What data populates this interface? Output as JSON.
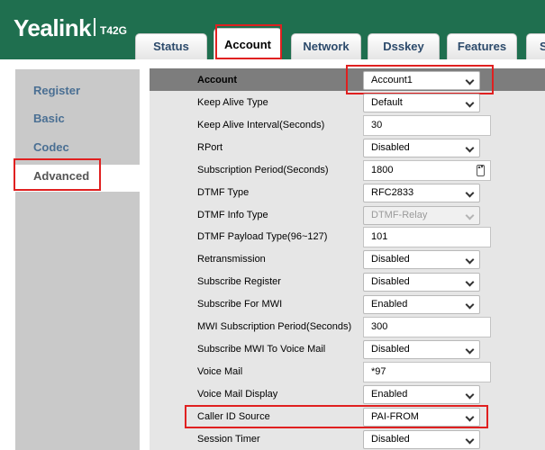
{
  "brand": {
    "logo": "Yealink",
    "model": "T42G"
  },
  "tabs": [
    {
      "label": "Status"
    },
    {
      "label": "Account"
    },
    {
      "label": "Network"
    },
    {
      "label": "Dsskey"
    },
    {
      "label": "Features"
    },
    {
      "label": "S"
    }
  ],
  "sidebar": {
    "items": [
      {
        "label": "Register"
      },
      {
        "label": "Basic"
      },
      {
        "label": "Codec"
      },
      {
        "label": "Advanced"
      }
    ]
  },
  "form": {
    "account": {
      "label": "Account",
      "value": "Account1"
    },
    "rows": [
      {
        "label": "Keep Alive Type",
        "type": "select",
        "value": "Default"
      },
      {
        "label": "Keep Alive Interval(Seconds)",
        "type": "input",
        "value": "30"
      },
      {
        "label": "RPort",
        "type": "select",
        "value": "Disabled"
      },
      {
        "label": "Subscription Period(Seconds)",
        "type": "spin",
        "value": "1800"
      },
      {
        "label": "DTMF Type",
        "type": "select",
        "value": "RFC2833"
      },
      {
        "label": "DTMF Info Type",
        "type": "select-disabled",
        "value": "DTMF-Relay"
      },
      {
        "label": "DTMF Payload Type(96~127)",
        "type": "input",
        "value": "101"
      },
      {
        "label": "Retransmission",
        "type": "select",
        "value": "Disabled"
      },
      {
        "label": "Subscribe Register",
        "type": "select",
        "value": "Disabled"
      },
      {
        "label": "Subscribe For MWI",
        "type": "select",
        "value": "Enabled"
      },
      {
        "label": "MWI Subscription Period(Seconds)",
        "type": "input",
        "value": "300"
      },
      {
        "label": "Subscribe MWI To Voice Mail",
        "type": "select",
        "value": "Disabled"
      },
      {
        "label": "Voice Mail",
        "type": "input",
        "value": "*97"
      },
      {
        "label": "Voice Mail Display",
        "type": "select",
        "value": "Enabled"
      },
      {
        "label": "Caller ID Source",
        "type": "select",
        "value": "PAI-FROM"
      },
      {
        "label": "Session Timer",
        "type": "select",
        "value": "Disabled"
      }
    ]
  },
  "colors": {
    "header": "#1f6f4f",
    "highlight": "#e02020",
    "sidebar": "#c9c9c9",
    "account_bar": "#7d7d7d"
  }
}
